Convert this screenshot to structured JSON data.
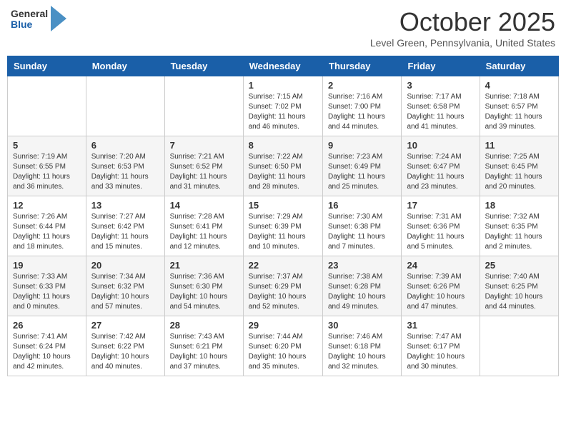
{
  "logo": {
    "general": "General",
    "blue": "Blue"
  },
  "header": {
    "month": "October 2025",
    "location": "Level Green, Pennsylvania, United States"
  },
  "days_of_week": [
    "Sunday",
    "Monday",
    "Tuesday",
    "Wednesday",
    "Thursday",
    "Friday",
    "Saturday"
  ],
  "weeks": [
    [
      {
        "day": "",
        "info": ""
      },
      {
        "day": "",
        "info": ""
      },
      {
        "day": "",
        "info": ""
      },
      {
        "day": "1",
        "info": "Sunrise: 7:15 AM\nSunset: 7:02 PM\nDaylight: 11 hours\nand 46 minutes."
      },
      {
        "day": "2",
        "info": "Sunrise: 7:16 AM\nSunset: 7:00 PM\nDaylight: 11 hours\nand 44 minutes."
      },
      {
        "day": "3",
        "info": "Sunrise: 7:17 AM\nSunset: 6:58 PM\nDaylight: 11 hours\nand 41 minutes."
      },
      {
        "day": "4",
        "info": "Sunrise: 7:18 AM\nSunset: 6:57 PM\nDaylight: 11 hours\nand 39 minutes."
      }
    ],
    [
      {
        "day": "5",
        "info": "Sunrise: 7:19 AM\nSunset: 6:55 PM\nDaylight: 11 hours\nand 36 minutes."
      },
      {
        "day": "6",
        "info": "Sunrise: 7:20 AM\nSunset: 6:53 PM\nDaylight: 11 hours\nand 33 minutes."
      },
      {
        "day": "7",
        "info": "Sunrise: 7:21 AM\nSunset: 6:52 PM\nDaylight: 11 hours\nand 31 minutes."
      },
      {
        "day": "8",
        "info": "Sunrise: 7:22 AM\nSunset: 6:50 PM\nDaylight: 11 hours\nand 28 minutes."
      },
      {
        "day": "9",
        "info": "Sunrise: 7:23 AM\nSunset: 6:49 PM\nDaylight: 11 hours\nand 25 minutes."
      },
      {
        "day": "10",
        "info": "Sunrise: 7:24 AM\nSunset: 6:47 PM\nDaylight: 11 hours\nand 23 minutes."
      },
      {
        "day": "11",
        "info": "Sunrise: 7:25 AM\nSunset: 6:45 PM\nDaylight: 11 hours\nand 20 minutes."
      }
    ],
    [
      {
        "day": "12",
        "info": "Sunrise: 7:26 AM\nSunset: 6:44 PM\nDaylight: 11 hours\nand 18 minutes."
      },
      {
        "day": "13",
        "info": "Sunrise: 7:27 AM\nSunset: 6:42 PM\nDaylight: 11 hours\nand 15 minutes."
      },
      {
        "day": "14",
        "info": "Sunrise: 7:28 AM\nSunset: 6:41 PM\nDaylight: 11 hours\nand 12 minutes."
      },
      {
        "day": "15",
        "info": "Sunrise: 7:29 AM\nSunset: 6:39 PM\nDaylight: 11 hours\nand 10 minutes."
      },
      {
        "day": "16",
        "info": "Sunrise: 7:30 AM\nSunset: 6:38 PM\nDaylight: 11 hours\nand 7 minutes."
      },
      {
        "day": "17",
        "info": "Sunrise: 7:31 AM\nSunset: 6:36 PM\nDaylight: 11 hours\nand 5 minutes."
      },
      {
        "day": "18",
        "info": "Sunrise: 7:32 AM\nSunset: 6:35 PM\nDaylight: 11 hours\nand 2 minutes."
      }
    ],
    [
      {
        "day": "19",
        "info": "Sunrise: 7:33 AM\nSunset: 6:33 PM\nDaylight: 11 hours\nand 0 minutes."
      },
      {
        "day": "20",
        "info": "Sunrise: 7:34 AM\nSunset: 6:32 PM\nDaylight: 10 hours\nand 57 minutes."
      },
      {
        "day": "21",
        "info": "Sunrise: 7:36 AM\nSunset: 6:30 PM\nDaylight: 10 hours\nand 54 minutes."
      },
      {
        "day": "22",
        "info": "Sunrise: 7:37 AM\nSunset: 6:29 PM\nDaylight: 10 hours\nand 52 minutes."
      },
      {
        "day": "23",
        "info": "Sunrise: 7:38 AM\nSunset: 6:28 PM\nDaylight: 10 hours\nand 49 minutes."
      },
      {
        "day": "24",
        "info": "Sunrise: 7:39 AM\nSunset: 6:26 PM\nDaylight: 10 hours\nand 47 minutes."
      },
      {
        "day": "25",
        "info": "Sunrise: 7:40 AM\nSunset: 6:25 PM\nDaylight: 10 hours\nand 44 minutes."
      }
    ],
    [
      {
        "day": "26",
        "info": "Sunrise: 7:41 AM\nSunset: 6:24 PM\nDaylight: 10 hours\nand 42 minutes."
      },
      {
        "day": "27",
        "info": "Sunrise: 7:42 AM\nSunset: 6:22 PM\nDaylight: 10 hours\nand 40 minutes."
      },
      {
        "day": "28",
        "info": "Sunrise: 7:43 AM\nSunset: 6:21 PM\nDaylight: 10 hours\nand 37 minutes."
      },
      {
        "day": "29",
        "info": "Sunrise: 7:44 AM\nSunset: 6:20 PM\nDaylight: 10 hours\nand 35 minutes."
      },
      {
        "day": "30",
        "info": "Sunrise: 7:46 AM\nSunset: 6:18 PM\nDaylight: 10 hours\nand 32 minutes."
      },
      {
        "day": "31",
        "info": "Sunrise: 7:47 AM\nSunset: 6:17 PM\nDaylight: 10 hours\nand 30 minutes."
      },
      {
        "day": "",
        "info": ""
      }
    ]
  ]
}
